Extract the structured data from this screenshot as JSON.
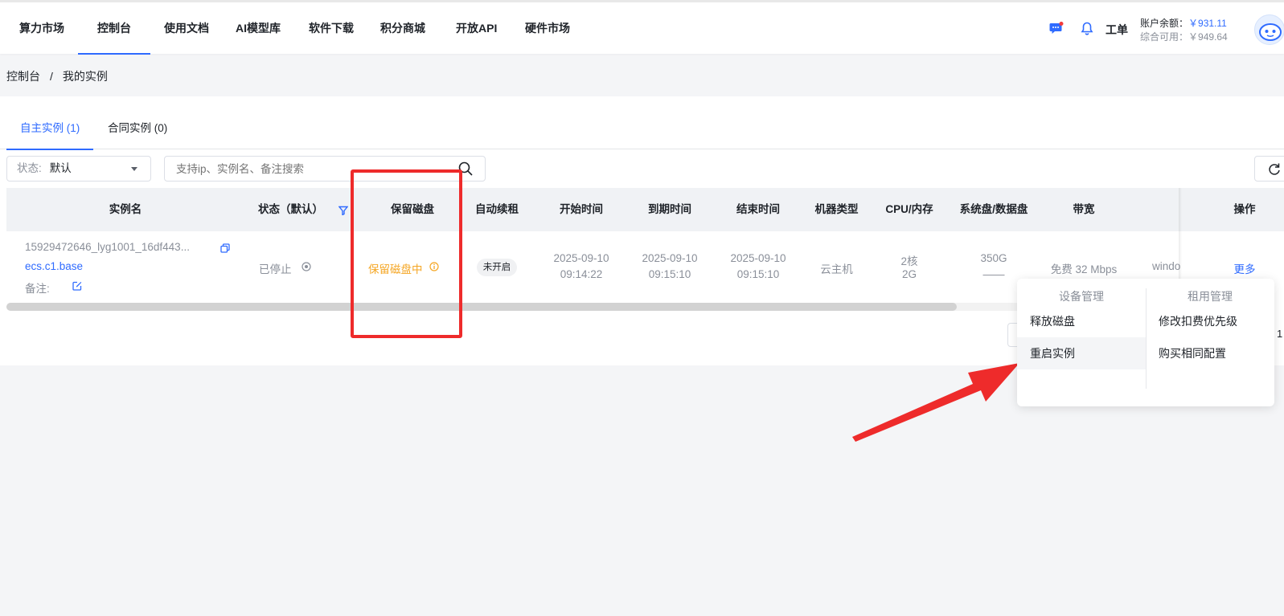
{
  "nav": {
    "items": [
      "算力市场",
      "控制台",
      "使用文档",
      "AI模型库",
      "软件下载",
      "积分商城",
      "开放API",
      "硬件市场"
    ],
    "active_index": 1,
    "ticket_label": "工单",
    "balance_label": "账户余额：",
    "balance_value": "￥931.11",
    "available_label": "综合可用：",
    "available_value": "￥949.64"
  },
  "breadcrumb": {
    "root": "控制台",
    "separator": "/",
    "current": "我的实例"
  },
  "tabs": [
    "自主实例 (1)",
    "合同实例 (0)"
  ],
  "filters": {
    "status_label": "状态:",
    "status_value": "默认",
    "search_placeholder": "支持ip、实例名、备注搜索"
  },
  "table": {
    "headers": [
      "实例名",
      "状态（默认）",
      "保留磁盘",
      "自动续租",
      "开始时间",
      "到期时间",
      "结束时间",
      "机器类型",
      "CPU/内存",
      "系统盘/数据盘",
      "带宽",
      "操作"
    ],
    "row": {
      "instance_id": "15929472646_lyg1001_16df443...",
      "instance_spec": "ecs.c1.base",
      "note_label": "备注:",
      "status": "已停止",
      "disk": "保留磁盘中",
      "auto_renew": "未开启",
      "start_date": "2025-09-10",
      "start_time": "09:14:22",
      "expire_date": "2025-09-10",
      "expire_time": "09:15:10",
      "end_date": "2025-09-10",
      "end_time": "09:15:10",
      "machine_type": "云主机",
      "cpu": "2核",
      "mem": "2G",
      "sys_disk": "350G",
      "data_disk": "——",
      "bandwidth": "免费 32 Mbps",
      "os_partial": "windo",
      "action": "更多"
    }
  },
  "pagination": {
    "page": "1"
  },
  "dropdown": {
    "col1_title": "设备管理",
    "col1_items": [
      "释放磁盘",
      "重启实例"
    ],
    "col2_title": "租用管理",
    "col2_items": [
      "修改扣费优先级",
      "购买相同配置"
    ]
  },
  "colors": {
    "primary": "#2f6bff",
    "warning": "#f5a623",
    "annotation_red": "#ee2b2b"
  }
}
